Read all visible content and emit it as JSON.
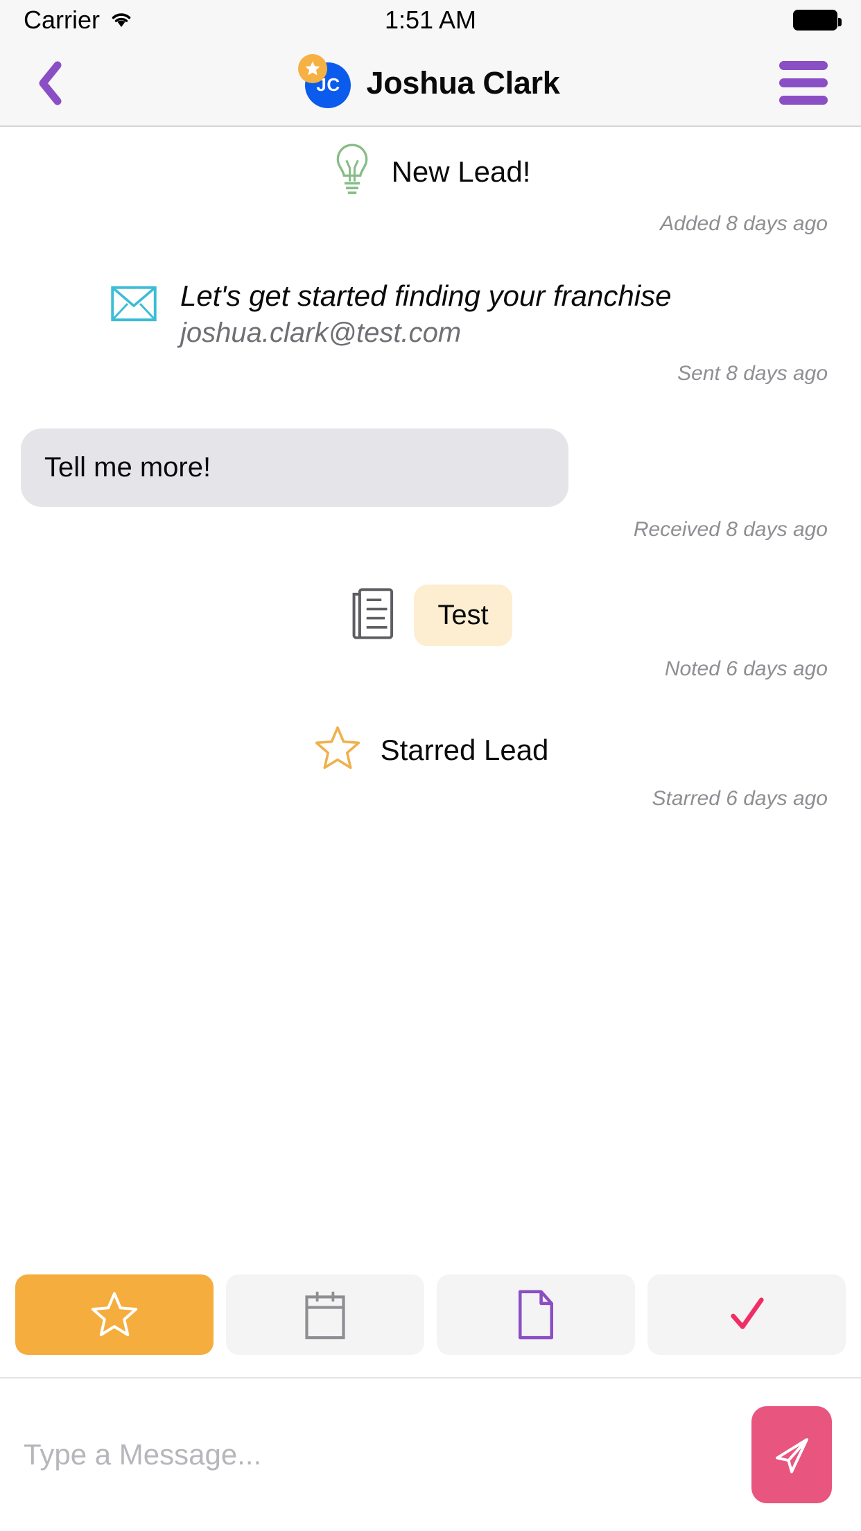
{
  "status_bar": {
    "carrier": "Carrier",
    "time": "1:51 AM",
    "wifi_icon": "wifi-icon",
    "battery_icon": "battery-full-icon"
  },
  "header": {
    "back_icon": "chevron-left-icon",
    "menu_icon": "hamburger-menu-icon",
    "avatar_initials": "JC",
    "avatar_badge_icon": "star-badge-icon",
    "title": "Joshua Clark",
    "colors": {
      "avatar_bg": "#0b5ced",
      "badge_bg": "#f5b143",
      "menu": "#8a4fc4",
      "back": "#8a4fc4"
    }
  },
  "timeline": [
    {
      "type": "lead",
      "icon": "lightbulb-icon",
      "icon_color": "#86bd86",
      "label": "New Lead!",
      "meta": "Added 8 days ago"
    },
    {
      "type": "email",
      "icon": "envelope-icon",
      "icon_color": "#3cbcd8",
      "subject": "Let's get started finding your franchise",
      "address": "joshua.clark@test.com",
      "meta": "Sent 8 days ago"
    },
    {
      "type": "message",
      "text": "Tell me more!",
      "meta": "Received 8 days ago",
      "bubble_color": "#e4e4e9"
    },
    {
      "type": "note",
      "icon": "note-document-icon",
      "icon_color": "#5e5e62",
      "text": "Test",
      "chip_color": "#fdeed1",
      "meta": "Noted 6 days ago"
    },
    {
      "type": "starred",
      "icon": "star-outline-icon",
      "icon_color": "#f0b04c",
      "label": "Starred Lead",
      "meta": "Starred 6 days ago"
    }
  ],
  "action_bar": [
    {
      "name": "star-action",
      "icon": "star-outline-icon",
      "active": true,
      "color": "#ffffff",
      "bg": "#f5ad3e"
    },
    {
      "name": "calendar-action",
      "icon": "calendar-icon",
      "active": false,
      "color": "#8e8e93",
      "bg": "#f4f4f5"
    },
    {
      "name": "document-action",
      "icon": "document-icon",
      "active": false,
      "color": "#8a4fc4",
      "bg": "#f4f4f5"
    },
    {
      "name": "check-action",
      "icon": "check-icon",
      "active": false,
      "color": "#ef2e63",
      "bg": "#f4f4f5"
    }
  ],
  "composer": {
    "placeholder": "Type a Message...",
    "value": "",
    "send_icon": "send-paper-plane-icon",
    "send_bg": "#e8557f"
  }
}
